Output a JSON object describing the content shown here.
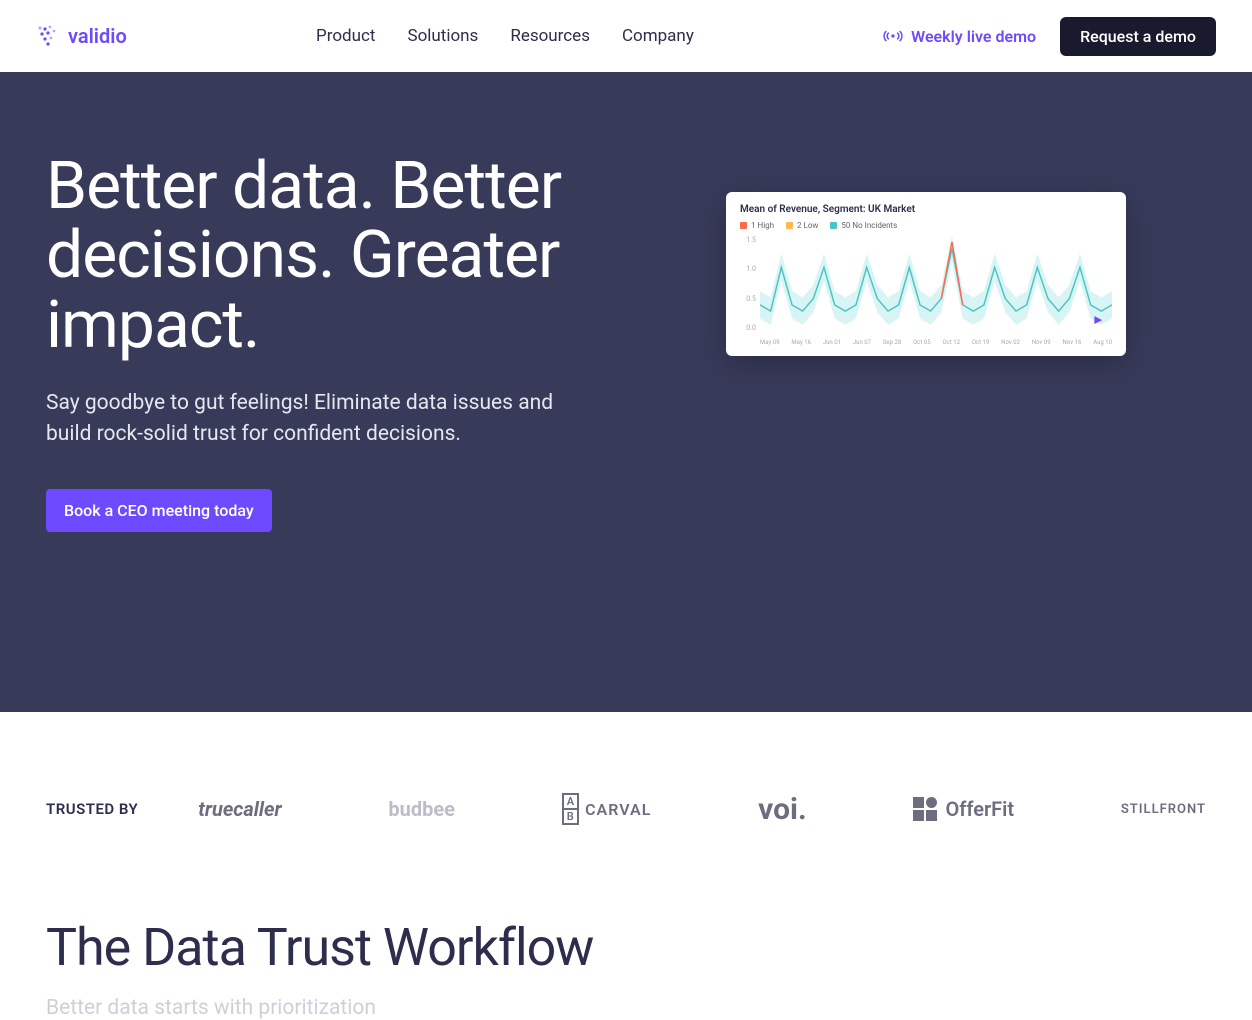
{
  "nav": {
    "brand": "validio",
    "links": [
      "Product",
      "Solutions",
      "Resources",
      "Company"
    ],
    "live_demo": "Weekly live demo",
    "cta": "Request a demo"
  },
  "hero": {
    "headline": "Better data. Better decisions. Greater impact.",
    "sub": "Say goodbye to gut feelings! Eliminate data issues and build rock-solid trust for confident decisions.",
    "cta": "Book a CEO meeting today"
  },
  "chart_data": {
    "type": "line",
    "title": "Mean of Revenue, Segment: UK Market",
    "series": [
      {
        "name": "1 High",
        "color": "#ff6a4d"
      },
      {
        "name": "2 Low",
        "color": "#ffb84d"
      },
      {
        "name": "50 No Incidents",
        "color": "#49c5c2"
      }
    ],
    "ylim": [
      0.0,
      1.5
    ],
    "y_ticks": [
      "1.5",
      "1.0",
      "0.5",
      "0.0"
    ],
    "x_ticks": [
      "May 09",
      "May 16",
      "Jun 01",
      "Jun 07",
      "Sep 28",
      "Oct 05",
      "Oct 12",
      "Oct 19",
      "Nov 02",
      "Nov 09",
      "Nov 16",
      "Aug 10"
    ],
    "values_main": [
      0.4,
      0.3,
      1.0,
      0.4,
      0.3,
      0.5,
      1.0,
      0.4,
      0.3,
      0.4,
      1.0,
      0.5,
      0.3,
      0.4,
      1.0,
      0.4,
      0.3,
      0.5,
      1.3,
      0.4,
      0.3,
      0.4,
      1.0,
      0.5,
      0.3,
      0.4,
      1.0,
      0.5,
      0.3,
      0.5,
      1.0,
      0.4,
      0.3,
      0.4
    ],
    "anomaly_index": 18
  },
  "trusted": {
    "label": "TRUSTED BY",
    "clients": [
      "truecaller",
      "budbee",
      "CARVAL",
      "voi.",
      "OfferFit",
      "STILLFRONT"
    ]
  },
  "workflow": {
    "heading": "The Data Trust Workflow",
    "sub": "Better data starts with prioritization"
  }
}
